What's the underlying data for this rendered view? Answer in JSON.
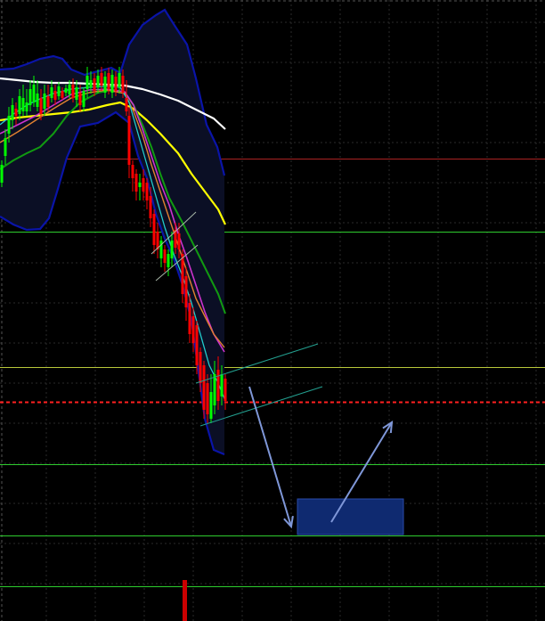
{
  "colors": {
    "background": "#000000",
    "grid": "#2a2a2a",
    "candle_up": "#00ff00",
    "candle_down": "#ff0000",
    "bollinger": "#0a14a8",
    "bollinger_fill": "#0b0f25",
    "ma_white": "#ffffff",
    "ma_yellow": "#ffff00",
    "ma_green": "#119a11",
    "ma_magenta": "#cc33cc",
    "ma_orange": "#e08030",
    "ma_cyan": "#22cccc",
    "level_green": "#2ecc2e",
    "level_red": "#aa2222",
    "level_yellow": "#b8c83a",
    "current_price": "#ff2020",
    "channel": "#23a090",
    "arrow": "#7f97d8",
    "target_zone": "#0f2a70",
    "volume_bar": "#cc0000"
  },
  "chart_data": {
    "type": "candlestick",
    "title": "",
    "xlabel": "",
    "ylabel": "",
    "ylim": [
      0,
      697
    ],
    "grid": true,
    "legend": "none",
    "candles": [],
    "indicators": {
      "bollinger_upper": [],
      "bollinger_lower": [],
      "ma_white": [],
      "ma_yellow": [],
      "ma_green": [],
      "ma_magenta": [],
      "ma_orange": [],
      "ma_cyan": []
    },
    "horizontal_levels": [
      {
        "kind": "resistance",
        "value": 519,
        "color_key": "level_red"
      },
      {
        "kind": "support",
        "value": 437,
        "color_key": "level_green"
      },
      {
        "kind": "support",
        "value": 285,
        "color_key": "level_yellow"
      },
      {
        "kind": "current_price",
        "value": 246,
        "color_key": "current_price"
      },
      {
        "kind": "support",
        "value": 176,
        "color_key": "level_green"
      },
      {
        "kind": "support",
        "value": 96,
        "color_key": "level_green"
      },
      {
        "kind": "support",
        "value": 39,
        "color_key": "level_green"
      }
    ],
    "annotations": [
      {
        "kind": "channel",
        "from": [
          52,
          278
        ],
        "to": [
          81,
          311
        ]
      },
      {
        "kind": "channel",
        "from": [
          52,
          219
        ],
        "to": [
          81,
          262
        ]
      },
      {
        "kind": "arrow",
        "from": [
          63,
          262
        ],
        "to": [
          78,
          106
        ]
      },
      {
        "kind": "arrow",
        "from": [
          85,
          110
        ],
        "to": [
          100,
          223
        ]
      },
      {
        "kind": "target_zone",
        "x": [
          76,
          102
        ],
        "y": [
          97,
          137
        ]
      }
    ]
  }
}
